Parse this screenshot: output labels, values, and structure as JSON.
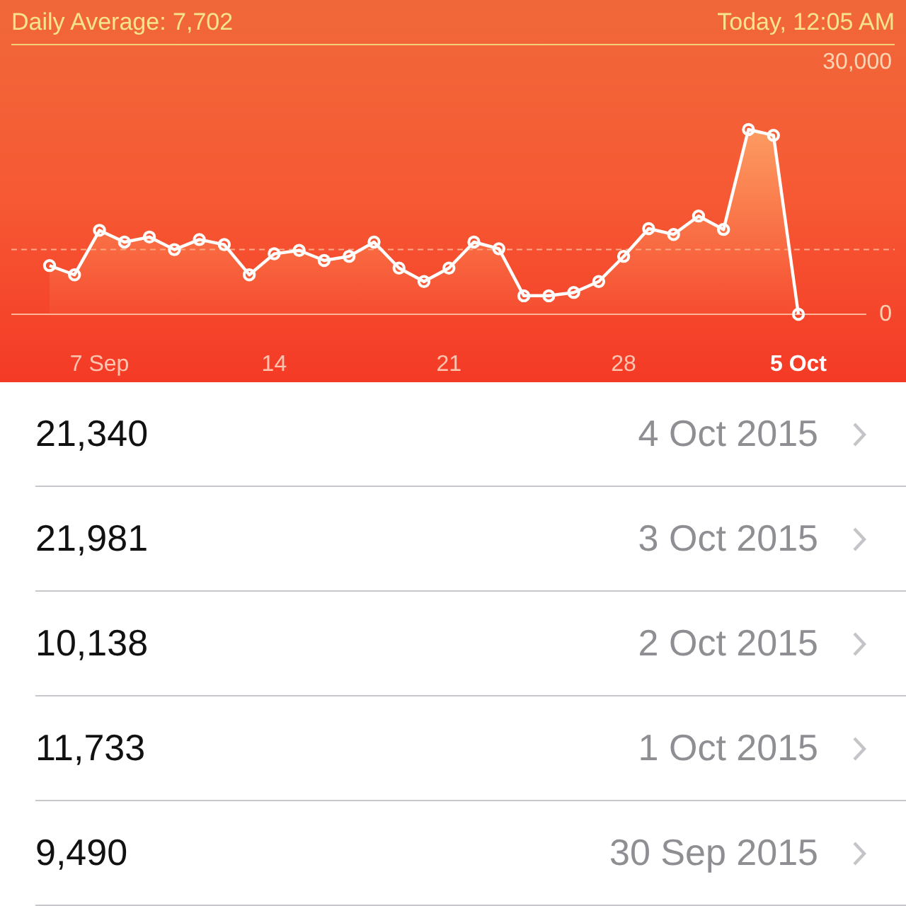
{
  "header": {
    "average": "Daily Average: 7,702",
    "timestamp": "Today, 12:05 AM"
  },
  "chart": {
    "chart_data": {
      "type": "area",
      "categories": [
        null,
        null,
        "7 Sep",
        null,
        null,
        null,
        null,
        null,
        null,
        "14",
        null,
        null,
        null,
        null,
        null,
        null,
        "21",
        null,
        null,
        null,
        null,
        null,
        null,
        "28",
        null,
        null,
        null,
        null,
        null,
        null,
        "5 Oct"
      ],
      "series": [
        {
          "color": "#ffffff",
          "marker": "o",
          "values": [
            5800,
            4700,
            10000,
            8600,
            9200,
            7700,
            8900,
            8300,
            4700,
            7200,
            7600,
            6400,
            6900,
            8600,
            5500,
            3900,
            5500,
            8600,
            7800,
            2200,
            2200,
            2600,
            3900,
            6900,
            10200,
            9500,
            11700,
            10100,
            22000,
            21300,
            0
          ]
        }
      ],
      "ylim": [
        0,
        30000
      ],
      "yticks": [
        0,
        {
          "value": 30000,
          "label": "30,000"
        }
      ],
      "ref_lines": [
        {
          "axis": "y",
          "value": 7702
        }
      ]
    }
  },
  "rows": [
    {
      "value": "21,340",
      "date": "4 Oct 2015"
    },
    {
      "value": "21,981",
      "date": "3 Oct 2015"
    },
    {
      "value": "10,138",
      "date": "2 Oct 2015"
    },
    {
      "value": "11,733",
      "date": "1 Oct 2015"
    },
    {
      "value": "9,490",
      "date": "30 Sep 2015"
    }
  ]
}
